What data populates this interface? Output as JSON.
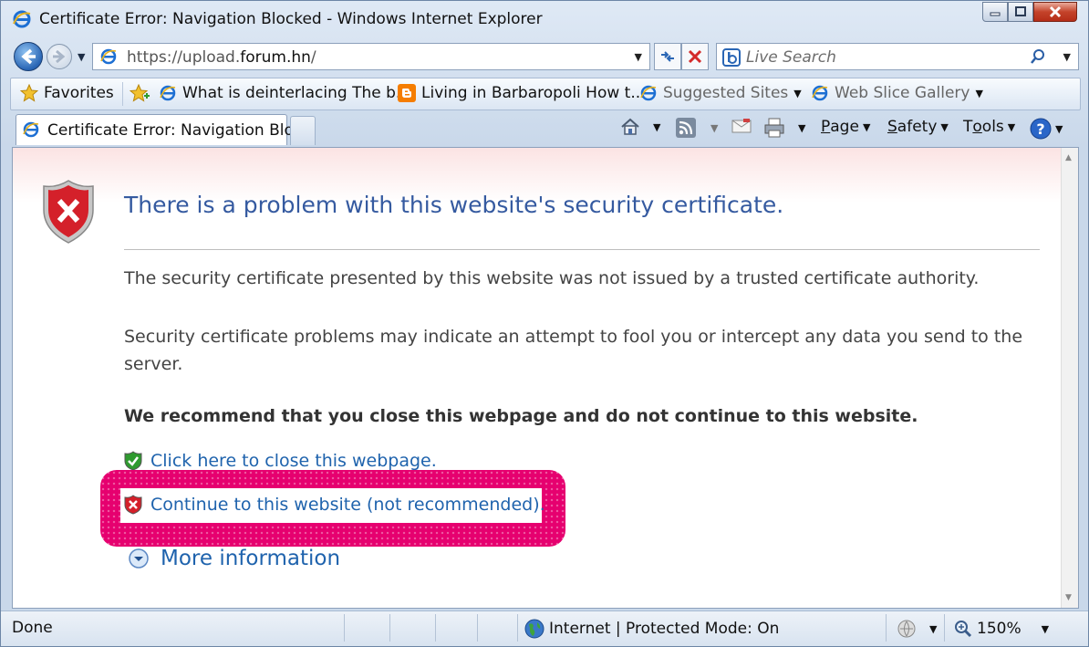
{
  "window": {
    "title": "Certificate Error: Navigation Blocked - Windows Internet Explorer"
  },
  "address_bar": {
    "url_prefix": "https://upload.",
    "url_domain": "forum.hn",
    "url_suffix": "/"
  },
  "search": {
    "placeholder": "Live Search"
  },
  "favorites_bar": {
    "favorites_label": "Favorites",
    "items": [
      {
        "label": "What is deinterlacing The b..."
      },
      {
        "label": "Living in Barbaropoli How t..."
      },
      {
        "label": "Suggested Sites"
      },
      {
        "label": "Web Slice Gallery"
      }
    ]
  },
  "tab": {
    "label": "Certificate Error: Navigation Blo..."
  },
  "command_bar": {
    "page_prefix": "",
    "page_u": "P",
    "page_rest": "age",
    "safety_u": "S",
    "safety_rest": "afety",
    "tools_prefix": "T",
    "tools_u": "o",
    "tools_rest": "ols"
  },
  "content": {
    "title": "There is a problem with this website's security certificate.",
    "para1": "The security certificate presented by this website was not issued by a trusted certificate authority.",
    "para2": "Security certificate problems may indicate an attempt to fool you or intercept any data you send to the server.",
    "recommendation": "We recommend that you close this webpage and do not continue to this website.",
    "close_link": "Click here to close this webpage.",
    "continue_link": "Continue to this website (not recommended).",
    "more_info": "More information"
  },
  "status_bar": {
    "status": "Done",
    "zone": "Internet | Protected Mode: On",
    "zoom": "150%"
  },
  "colors": {
    "highlight": "#e6006f",
    "title_blue": "#355aa0",
    "link_blue": "#1f63ad"
  }
}
